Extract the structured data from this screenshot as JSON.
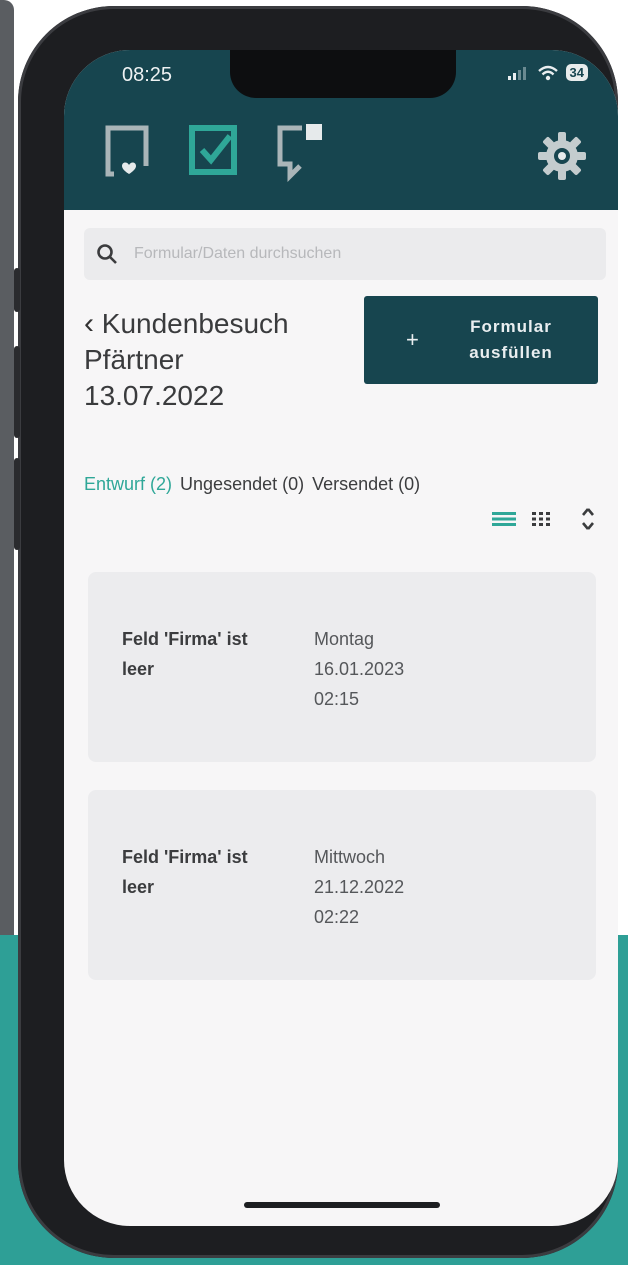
{
  "status_bar": {
    "time": "08:25",
    "battery": "34"
  },
  "colors": {
    "header_bg": "#17454f",
    "accent": "#2fa798",
    "card_bg": "#ececee",
    "teal_bg": "#2e9f96"
  },
  "header": {
    "icons": [
      "form-heart-icon",
      "checkbox-icon",
      "chat-form-icon"
    ],
    "settings_icon": "gear-icon"
  },
  "search": {
    "placeholder": "Formular/Daten durchsuchen"
  },
  "page": {
    "title_lines": [
      "Kundenbesuch",
      "Pfärtner",
      "13.07.2022"
    ],
    "action_button": {
      "icon": "+",
      "label": "Formular\nausfüllen"
    }
  },
  "tabs": [
    {
      "label": "Entwurf (2)",
      "active": true
    },
    {
      "label": "Ungesendet (0)",
      "active": false
    },
    {
      "label": "Versendet (0)",
      "active": false
    }
  ],
  "entries": [
    {
      "title": "Feld 'Firma' ist leer",
      "weekday": "Montag",
      "date": "16.01.2023",
      "time": "02:15"
    },
    {
      "title": "Feld 'Firma' ist leer",
      "weekday": "Mittwoch",
      "date": "21.12.2022",
      "time": "02:22"
    }
  ]
}
